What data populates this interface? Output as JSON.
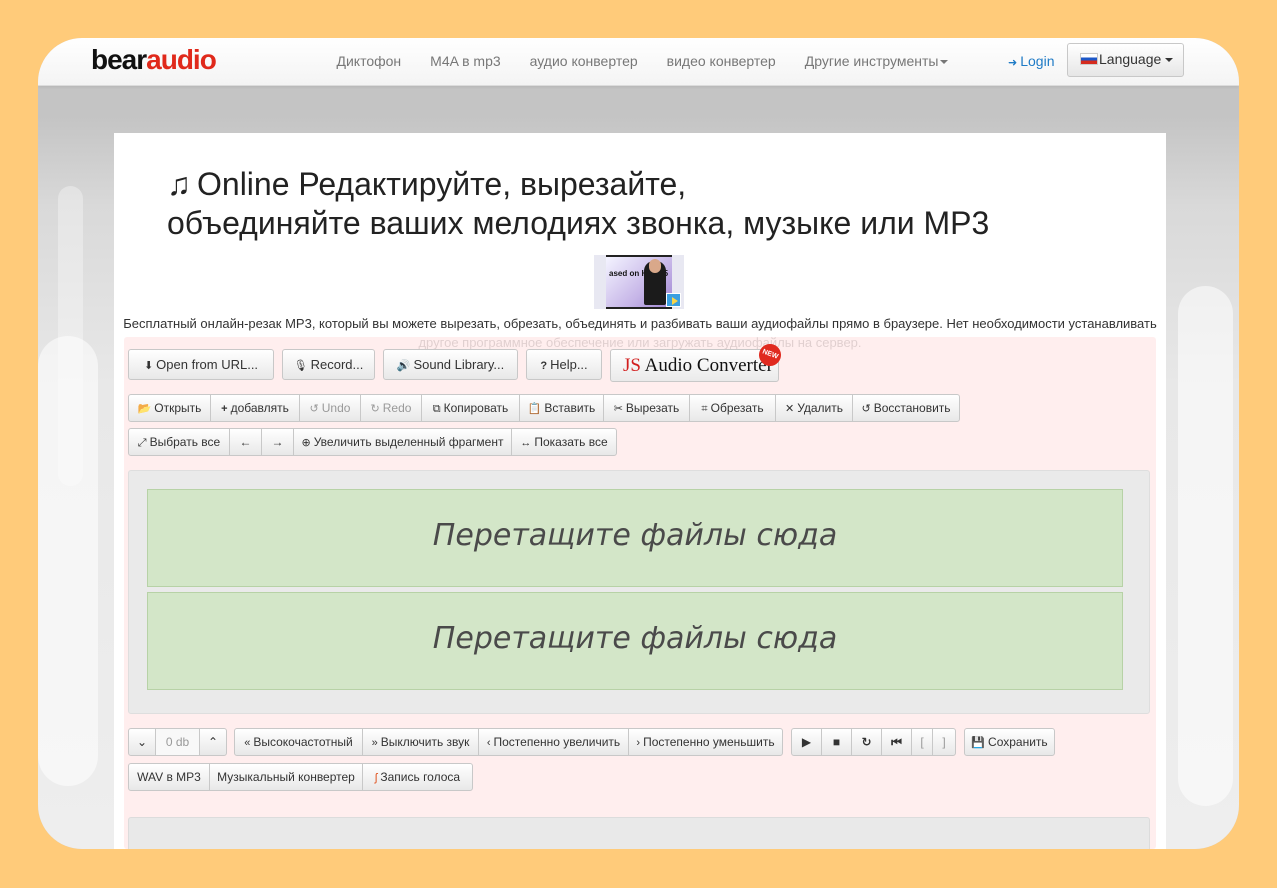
{
  "navbar": {
    "logo_dark": "bear",
    "logo_red": "audio",
    "links": [
      "Диктофон",
      "M4A в mp3",
      "аудио конвертер",
      "видео конвертер",
      "Другие инструменты"
    ],
    "login": "Login",
    "language": "Language"
  },
  "header": {
    "title_line1": "Online Редактируйте, вырезайте,",
    "title_line2": "объединяйте ваших мелодиях звонка, музыке или MP3",
    "video_thumb_text": "ased on HTML5",
    "description": "Бесплатный онлайн-резак MP3, который вы можете вырезать, обрезать, объединять и разбивать ваши аудиофайлы прямо в браузере. Нет необходимости устанавливать другое программное обеспечение или загружать аудиофайлы на сервер."
  },
  "toolbar_top": {
    "open_url": "Open from URL...",
    "record": "Record...",
    "sound_library": "Sound Library...",
    "help": "Help...",
    "js_converter_js": "JS",
    "js_converter_rest": "Audio Converter",
    "new_badge": "NEW"
  },
  "toolbar_edit": {
    "open": "Открыть",
    "add": "добавлять",
    "undo": "Undo",
    "redo": "Redo",
    "copy": "Копировать",
    "paste": "Вставить",
    "cut": "Вырезать",
    "crop": "Обрезать",
    "delete": "Удалить",
    "restore": "Восстановить"
  },
  "toolbar_select": {
    "select_all": "Выбрать все",
    "left": "←",
    "right": "→",
    "zoom_selection": "Увеличить выделенный фрагмент",
    "show_all": "Показать все"
  },
  "tracks": {
    "drop1": "Перетащите файлы сюда",
    "drop2": "Перетащите файлы сюда"
  },
  "toolbar_effects": {
    "volume": "0 db",
    "high_freq": "Высокочастотный",
    "mute": "Выключить звук",
    "fade_in": "Постепенно увеличить",
    "fade_out": "Постепенно уменьшить",
    "bracket_open": "[",
    "bracket_close": "]",
    "save": "Сохранить"
  },
  "toolbar_links": {
    "wav_mp3": "WAV в MP3",
    "music_converter": "Музыкальный конвертер",
    "voice_record": "Запись голоса"
  }
}
